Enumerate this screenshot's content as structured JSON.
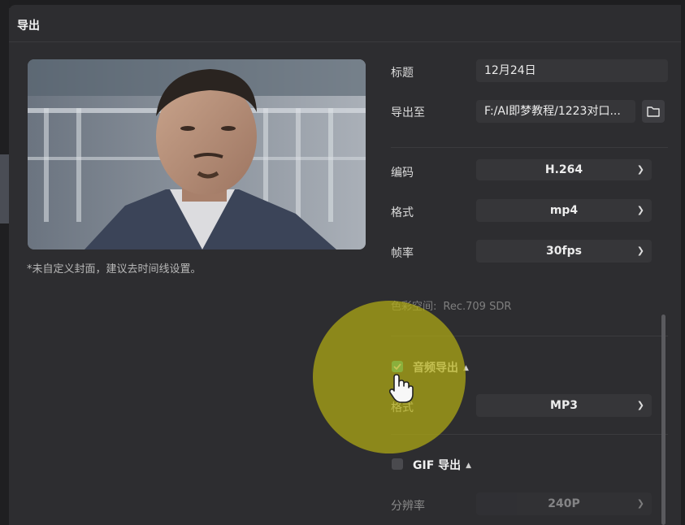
{
  "dialog": {
    "title": "导出"
  },
  "cover": {
    "note": "*未自定义封面，建议去时间线设置。"
  },
  "fields": {
    "title_label": "标题",
    "title_value": "12月24日",
    "export_to_label": "导出至",
    "export_to_value": "F:/AI即梦教程/1223对口..."
  },
  "video": {
    "codec_label": "编码",
    "codec_value": "H.264",
    "format_label": "格式",
    "format_value": "mp4",
    "framerate_label": "帧率",
    "framerate_value": "30fps",
    "colorspace_label": "色彩空间:",
    "colorspace_value": "Rec.709 SDR"
  },
  "audio": {
    "section_label": "音频导出",
    "checked": true,
    "format_label": "格式",
    "format_value": "MP3"
  },
  "gif": {
    "section_label": "GIF 导出",
    "checked": false,
    "resolution_label": "分辨率",
    "resolution_value": "240P"
  },
  "colors": {
    "accent": "#26b7a5",
    "spotlight": "#b2ac14",
    "background": "#2d2d30"
  }
}
